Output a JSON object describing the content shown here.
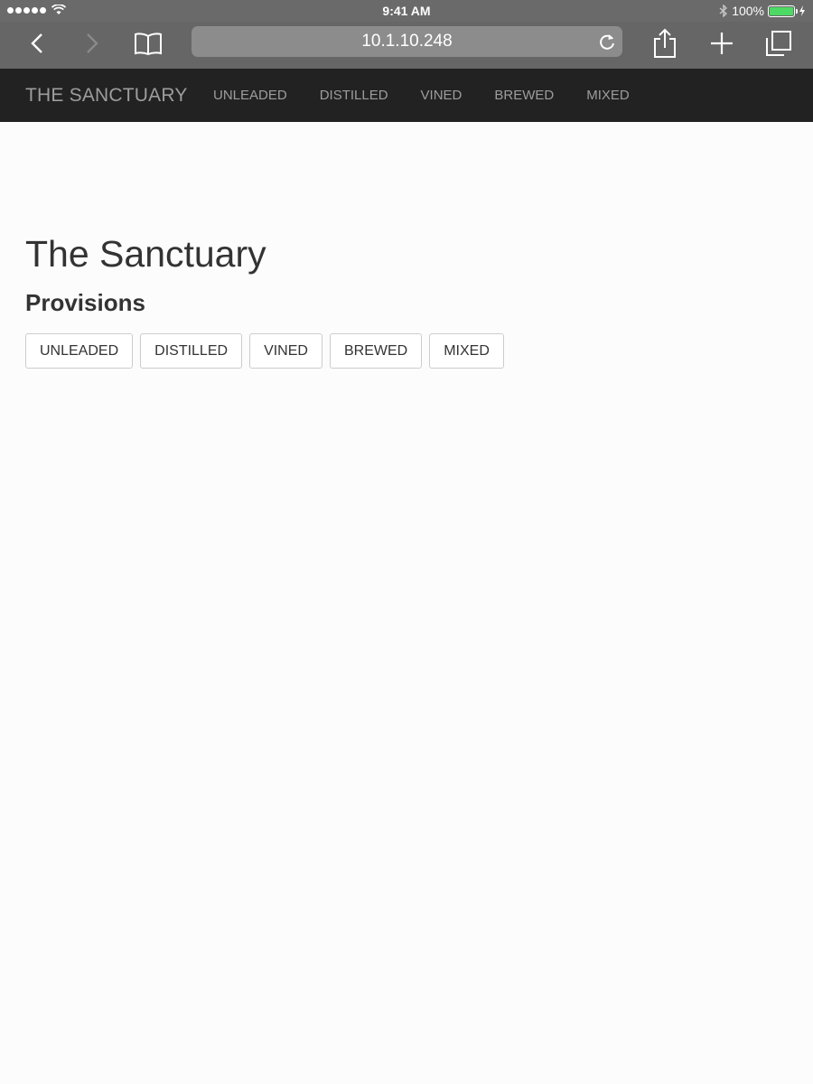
{
  "status_bar": {
    "time": "9:41 AM",
    "battery_text": "100%",
    "battery_color": "#4cd964",
    "icons": [
      "signal-dots-icon",
      "wifi-icon",
      "bluetooth-icon",
      "battery-icon",
      "charging-icon"
    ]
  },
  "browser": {
    "url": "10.1.10.248",
    "icons": [
      "back-arrow-icon",
      "forward-arrow-icon",
      "bookmarks-icon",
      "reload-icon",
      "share-icon",
      "new-tab-icon",
      "tabs-icon"
    ]
  },
  "navbar": {
    "brand": "THE SANCTUARY",
    "links": [
      "UNLEADED",
      "DISTILLED",
      "VINED",
      "BREWED",
      "MIXED"
    ],
    "background": "#222222",
    "text_color": "#9d9d9d"
  },
  "main": {
    "title": "The Sanctuary",
    "subtitle": "Provisions",
    "buttons": [
      "UNLEADED",
      "DISTILLED",
      "VINED",
      "BREWED",
      "MIXED"
    ]
  }
}
